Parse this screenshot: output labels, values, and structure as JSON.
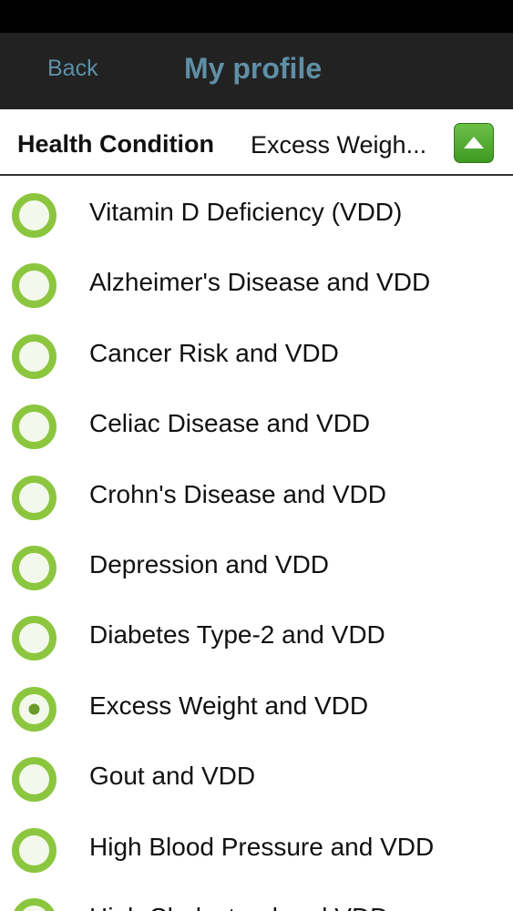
{
  "nav": {
    "back_label": "Back",
    "title": "My profile"
  },
  "condition": {
    "label": "Health Condition",
    "value": "Excess Weigh..."
  },
  "conditions": [
    {
      "label": "Vitamin D Deficiency (VDD)",
      "selected": false
    },
    {
      "label": "Alzheimer's Disease and VDD",
      "selected": false
    },
    {
      "label": "Cancer Risk and VDD",
      "selected": false
    },
    {
      "label": "Celiac Disease and VDD",
      "selected": false
    },
    {
      "label": "Crohn's Disease and VDD",
      "selected": false
    },
    {
      "label": "Depression and VDD",
      "selected": false
    },
    {
      "label": "Diabetes Type-2 and VDD",
      "selected": false
    },
    {
      "label": "Excess Weight and VDD",
      "selected": true
    },
    {
      "label": "Gout and VDD",
      "selected": false
    },
    {
      "label": "High Blood Pressure and VDD",
      "selected": false
    },
    {
      "label": "High Cholesterol and VDD",
      "selected": false
    }
  ],
  "colors": {
    "radio_ring": "#8cc63f",
    "radio_fill": "#f4f8ec",
    "radio_dot": "#6a9a2a",
    "nav_text": "#5f8fa6"
  },
  "icons": {
    "toggle": "triangle-up-icon",
    "radio": "radio-icon"
  }
}
